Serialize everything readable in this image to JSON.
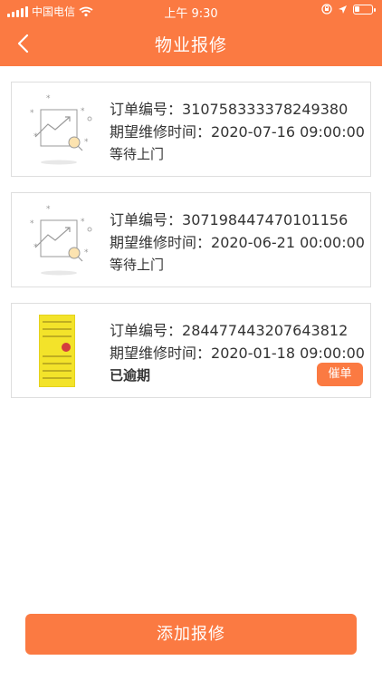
{
  "status_bar": {
    "carrier": "中国电信",
    "time": "上午 9:30"
  },
  "nav": {
    "title": "物业报修"
  },
  "orders": [
    {
      "order_label": "订单编号：",
      "order_no": "310758333378249380",
      "time_label": "期望维修时间：",
      "time": "2020-07-16 09:00:00",
      "status": "等待上门",
      "status_kind": "waiting"
    },
    {
      "order_label": "订单编号：",
      "order_no": "307198447470101156",
      "time_label": "期望维修时间：",
      "time": "2020-06-21 00:00:00",
      "status": "等待上门",
      "status_kind": "waiting"
    },
    {
      "order_label": "订单编号：",
      "order_no": "284477443207643812",
      "time_label": "期望维修时间：",
      "time": "2020-01-18 09:00:00",
      "status": "已逾期",
      "status_kind": "overdue",
      "action": "催单"
    }
  ],
  "bottom": {
    "add_label": "添加报修"
  },
  "colors": {
    "accent": "#FB7A42",
    "waiting": "#F59A7A",
    "overdue": "#E62A2A"
  },
  "icons": [
    "back-icon",
    "wifi-icon",
    "location-icon",
    "lock-rotation-icon",
    "battery-icon",
    "placeholder-chart-icon"
  ]
}
